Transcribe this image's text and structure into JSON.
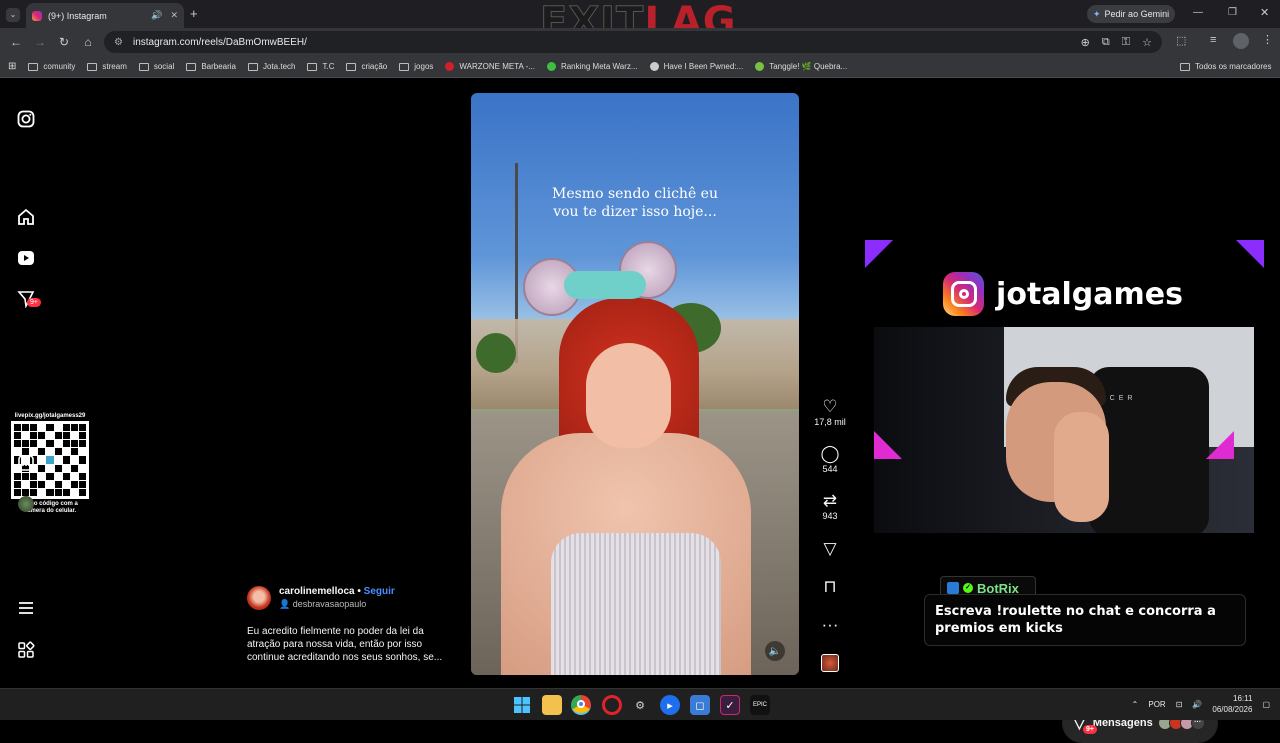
{
  "browser": {
    "tab_title": "(9+) Instagram",
    "url": "instagram.com/reels/DaBmOmwBEEH/",
    "gemini_label": "Pedir ao Gemini",
    "bookmarks": [
      {
        "label": "comunity"
      },
      {
        "label": "stream"
      },
      {
        "label": "social"
      },
      {
        "label": "Barbearia"
      },
      {
        "label": "Jota.tech"
      },
      {
        "label": "T.C"
      },
      {
        "label": "criação"
      },
      {
        "label": "jogos"
      },
      {
        "label": "WARZONE META -..."
      },
      {
        "label": "Ranking Meta Warz..."
      },
      {
        "label": "Have I Been Pwned:..."
      },
      {
        "label": "Tanggle! 🌿 Quebra..."
      }
    ],
    "all_bookmarks": "Todos os marcadores"
  },
  "overlay_logo": {
    "part1": "EXIT",
    "part2": "LAG"
  },
  "sidebar": {
    "notifications_badge": "9+",
    "qr_url": "livepix.gg/jotalgamess29",
    "qr_caption": "leia o código com a câmera do celular."
  },
  "reel": {
    "overlay_text_line1": "Mesmo sendo clichê eu",
    "overlay_text_line2": "vou te dizer isso hoje...",
    "username": "carolinemelloca",
    "follow": "Seguir",
    "audio": "desbravasaopaulo",
    "caption": "Eu acredito fielmente no poder da lei da atração para nossa vida, então por isso continue acreditando nos seus sonhos, se...",
    "likes": "17,8 mil",
    "comments": "544",
    "reposts": "943"
  },
  "stream_overlay": {
    "channel": "jotalgames",
    "bot_name": "BotRix",
    "bot_message": "Escreva !roulette no chat e concorra a premios em kicks",
    "webcam_text": "ACER"
  },
  "messages": {
    "label": "Mensagens",
    "badge": "9+"
  },
  "taskbar": {
    "lang": "POR",
    "time": "16:11",
    "date": "06/08/2026"
  },
  "colors": {
    "accent": "#0095f6",
    "badge": "#ff3040",
    "botrix": "#53fc18"
  }
}
